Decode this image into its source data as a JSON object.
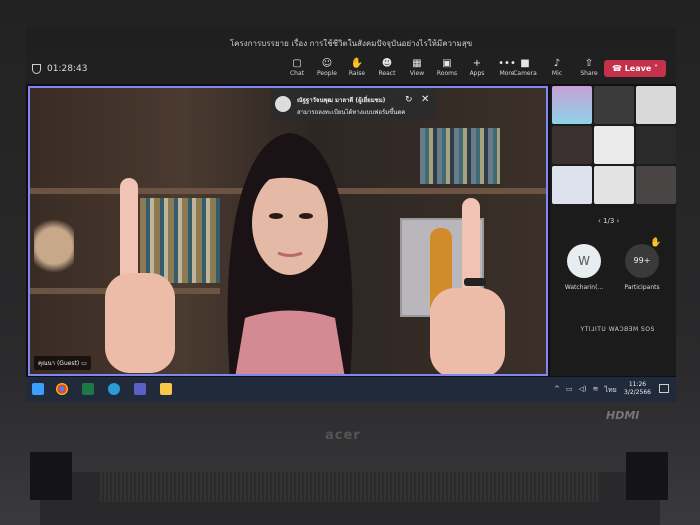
{
  "window": {
    "title": "โครงการบรรยาย เรื่อง การใช้ชีวิตในสังคมปัจจุบันอย่างไรให้มีความสุข"
  },
  "meeting": {
    "timer": "01:28:43"
  },
  "toolbar": {
    "items": [
      {
        "label": "Chat",
        "icon": "chat-icon"
      },
      {
        "label": "People",
        "icon": "people-icon"
      },
      {
        "label": "Raise",
        "icon": "hand-icon"
      },
      {
        "label": "React",
        "icon": "smile-icon"
      },
      {
        "label": "View",
        "icon": "grid-icon"
      },
      {
        "label": "Rooms",
        "icon": "rooms-icon"
      },
      {
        "label": "Apps",
        "icon": "plus-icon"
      },
      {
        "label": "More",
        "icon": "more-icon"
      }
    ],
    "camera": "Camera",
    "mic": "Mic",
    "share": "Share",
    "leave": "Leave"
  },
  "notification": {
    "name": "ณัฐฐาวัจนพุฒ มาลาดี (ผู้เยี่ยมชม)",
    "message": "สามารถลงทะเบียนได้ทางแบบฟอร์มขึ้นตค"
  },
  "stage": {
    "name_tag": "คุณนา (Guest)"
  },
  "sidebar": {
    "pager": "1/3",
    "watcher_initial": "W",
    "watcher_label": "Watcharin(...",
    "participants_count": "99+",
    "participants_label": "Participants",
    "mirror_text": "ƧOƧ MEBCAW UTILITY"
  },
  "taskbar": {
    "lang": "ไทย",
    "time": "11:26",
    "date": "3/2/2566"
  },
  "laptop": {
    "brand": "acer",
    "port": "HDMI"
  },
  "colors": {
    "leave": "#c4314b",
    "active_border": "#7f85f5",
    "toolbar": "#202020"
  }
}
